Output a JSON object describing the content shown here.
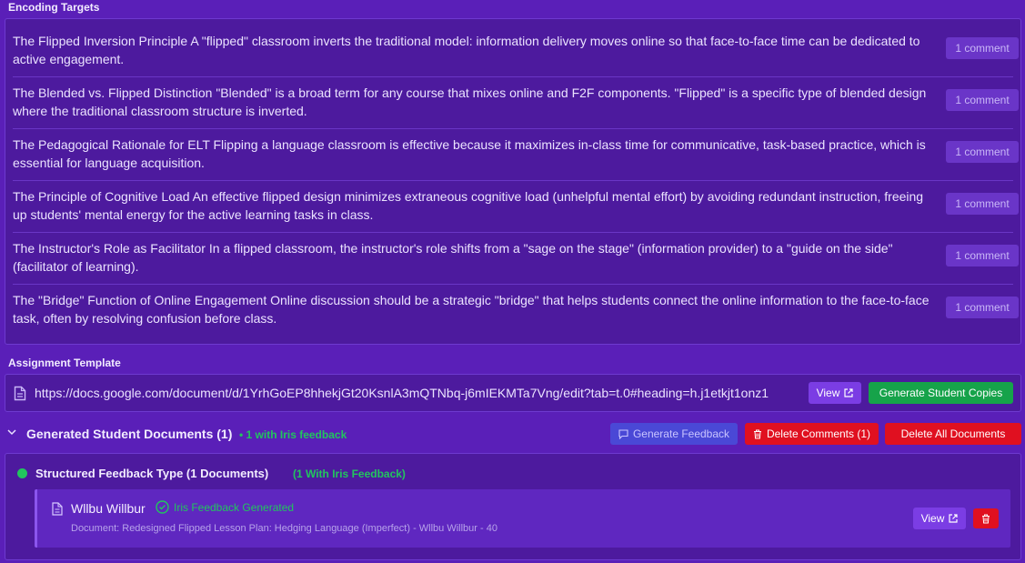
{
  "encoding_targets": {
    "title": "Encoding Targets",
    "items": [
      {
        "text": "The Flipped Inversion Principle A \"flipped\" classroom inverts the traditional model: information delivery moves online so that face-to-face time can be dedicated to active engagement.",
        "comments": "1 comment"
      },
      {
        "text": "The Blended vs. Flipped Distinction \"Blended\" is a broad term for any course that mixes online and F2F components. \"Flipped\" is a specific type of blended design where the traditional classroom structure is inverted.",
        "comments": "1 comment"
      },
      {
        "text": "The Pedagogical Rationale for ELT Flipping a language classroom is effective because it maximizes in-class time for communicative, task-based practice, which is essential for language acquisition.",
        "comments": "1 comment"
      },
      {
        "text": "The Principle of Cognitive Load An effective flipped design minimizes extraneous cognitive load (unhelpful mental effort) by avoiding redundant instruction, freeing up students' mental energy for the active learning tasks in class.",
        "comments": "1 comment"
      },
      {
        "text": "The Instructor's Role as Facilitator In a flipped classroom, the instructor's role shifts from a \"sage on the stage\" (information provider) to a \"guide on the side\" (facilitator of learning).",
        "comments": "1 comment"
      },
      {
        "text": "The \"Bridge\" Function of Online Engagement Online discussion should be a strategic \"bridge\" that helps students connect the online information to the face-to-face task, often by resolving confusion before class.",
        "comments": "1 comment"
      }
    ]
  },
  "assignment_template": {
    "title": "Assignment Template",
    "url": "https://docs.google.com/document/d/1YrhGoEP8hhekjGt20KsnlA3mQTNbq-j6mIEKMTa7Vng/edit?tab=t.0#heading=h.j1etkjt1onz1",
    "view_label": "View",
    "generate_copies_label": "Generate Student Copies"
  },
  "generated": {
    "title": "Generated Student Documents (1)",
    "subtitle": "• 1 with Iris feedback",
    "generate_feedback_label": "Generate Feedback",
    "delete_comments_label": "Delete Comments (1)",
    "delete_all_label": "Delete All Documents"
  },
  "group": {
    "title": "Structured Feedback Type (1 Documents)",
    "subtitle": "(1 With Iris Feedback)",
    "document": {
      "student": "Wllbu Willbur",
      "status": "Iris Feedback Generated",
      "description": "Document: Redesigned Flipped Lesson Plan: Hedging Language (Imperfect) - Wllbu Willbur - 40",
      "view_label": "View"
    }
  },
  "colors": {
    "background": "#5a1fb8",
    "panel": "#4d1a9e",
    "accent_green": "#22c55e",
    "danger_red": "#e01020",
    "view_purple": "#7b3de4"
  }
}
